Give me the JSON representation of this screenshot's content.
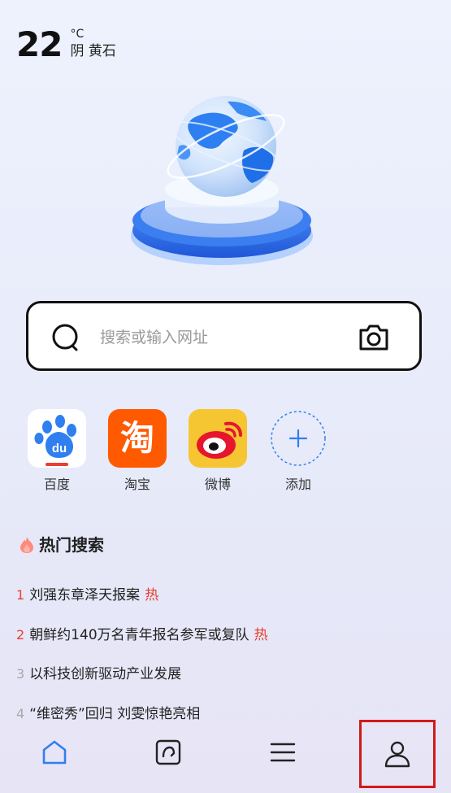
{
  "weather": {
    "temperature": "22",
    "unit": "°C",
    "description": "阴 黄石"
  },
  "search": {
    "placeholder": "搜索或输入网址"
  },
  "quick_links": [
    {
      "label": "百度",
      "icon": "baidu-icon"
    },
    {
      "label": "淘宝",
      "icon": "taobao-icon"
    },
    {
      "label": "微博",
      "icon": "weibo-icon"
    },
    {
      "label": "添加",
      "icon": "add-icon"
    }
  ],
  "hot_search": {
    "title": "热门搜索",
    "items": [
      {
        "rank": "1",
        "text": "刘强东章泽天报案",
        "tag": "热"
      },
      {
        "rank": "2",
        "text": "朝鲜约140万名青年报名参军或复队",
        "tag": "热"
      },
      {
        "rank": "3",
        "text": "以科技创新驱动产业发展",
        "tag": ""
      },
      {
        "rank": "4",
        "text": "“维密秀”回归 刘雯惊艳亮相",
        "tag": ""
      }
    ]
  },
  "bottom_nav": {
    "items": [
      "home-icon",
      "tabs-icon",
      "menu-icon",
      "profile-icon"
    ]
  },
  "colors": {
    "accent_blue": "#2f7ff0",
    "hot_red": "#e8402e",
    "highlight_red": "#d11a1a",
    "taobao_orange": "#ff5a00",
    "weibo_yellow": "#f6c532"
  }
}
